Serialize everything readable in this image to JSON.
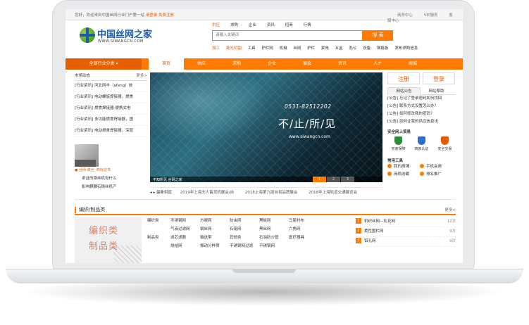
{
  "topbar": {
    "welcome": "您好，欢迎来到中国丝网行业门户第一站",
    "login": "请登录",
    "register": "免费注册",
    "links": [
      "商务中心",
      "VIP服务",
      "客服中心"
    ]
  },
  "logo": {
    "name": "中国丝网之家",
    "domain": "WWW.SIWANGCN.COM"
  },
  "search": {
    "tabs": [
      "供应",
      "求购",
      "企业",
      "资讯",
      "招商",
      "行情"
    ],
    "active_tab": "供应",
    "placeholder": "请输入关键词",
    "button": "搜 索",
    "hot": [
      "加工",
      "激光切割",
      "工具",
      "护栏网",
      "机械",
      "丝网",
      "护栏",
      "家电",
      "五金",
      "办公",
      "设备",
      "钢格板",
      "发布求购信息"
    ],
    "hot_highlight": [
      "加工",
      "激光切割"
    ]
  },
  "nav": {
    "category": "全部行业分类",
    "items": [
      "首页",
      "供应",
      "求购",
      "企业",
      "展会",
      "资讯",
      "人才",
      "商城"
    ],
    "active": "首页"
  },
  "left": {
    "header": "市场动态",
    "more": "更多>",
    "news": [
      "[行业资讯] 河北网丰（afeng）技",
      "[行业资讯] 电动螺旋焊接器，燃食",
      "[行业资讯] 燃食焊接器-便携式电",
      "[行业资讯] 多功能燃食焊接器，国",
      "[行业资讯] 电动燃食焊接器，深层"
    ],
    "caption": "● 丝网-铁丝 ·商标证书",
    "sub": [
      "卓且的钢丝机有什么",
      "影响麒麟石钢丝机产"
    ]
  },
  "banner": {
    "phone": "0531-82512202",
    "slogan": "不/止/所/见",
    "site": "www.siwangcn.com",
    "caption": "不知所见 丝网之家",
    "pages": [
      "1",
      "2",
      "3"
    ]
  },
  "ticker": {
    "label": "最新供应",
    "items": [
      "2019年上海无人售货机展会/自",
      "2018上海第九届自有品牌展会",
      "2018年上海轨道交通展览会"
    ]
  },
  "right": {
    "register": "注册",
    "login": "登录",
    "tabs": [
      "网站公告",
      "网站帮助"
    ],
    "active_tab": "网站公告",
    "notices": [
      "[公告] 忘记了登录密码如何找回",
      "[公告] 联系方式设置怎么办？",
      "[公告] 如何修改我的密码？",
      "[公告] 如何让我的供应信息出"
    ],
    "secure_title": "安全网上贸易",
    "secure": [
      {
        "label": "买家保障",
        "color": "#2e8b3a"
      },
      {
        "label": "商家认证",
        "color": "#2a6fc9"
      },
      {
        "label": "安全交易",
        "color": "#e55a00"
      }
    ],
    "tools_title": "常用工具",
    "tools": [
      "我的商铺",
      "手机会商",
      "商机收藏",
      "排名推广"
    ]
  },
  "section": {
    "title": "编织/制品类",
    "more": "更多>",
    "image_lines": [
      "编织类",
      "制品类"
    ],
    "rows": [
      {
        "key": "编织类",
        "items": [
          "不锈钢网",
          "方眼网",
          "防虫网",
          "黑板网",
          "马尾村布"
        ]
      },
      {
        "key": "",
        "items": [
          "气液过滤网",
          "钢丝网",
          "石笼网",
          "黑丝网",
          "六角网"
        ]
      },
      {
        "key": "制品类",
        "items": [
          "滤芯滤器",
          "输送带",
          "其他类",
          "石油防沙管",
          "医疗器具"
        ]
      },
      {
        "key": "",
        "items": [
          "烧结网",
          "振动分样筛",
          "不锈钢网过滤",
          "不锈钢网",
          ""
        ]
      }
    ],
    "rank": [
      {
        "n": "1",
        "name": "机织丝网—轧花网",
        "count": "12次"
      },
      {
        "n": "2",
        "name": "柔性围栏网",
        "count": "9次"
      },
      {
        "n": "3",
        "name": "铝孔网",
        "count": "9次"
      }
    ]
  }
}
